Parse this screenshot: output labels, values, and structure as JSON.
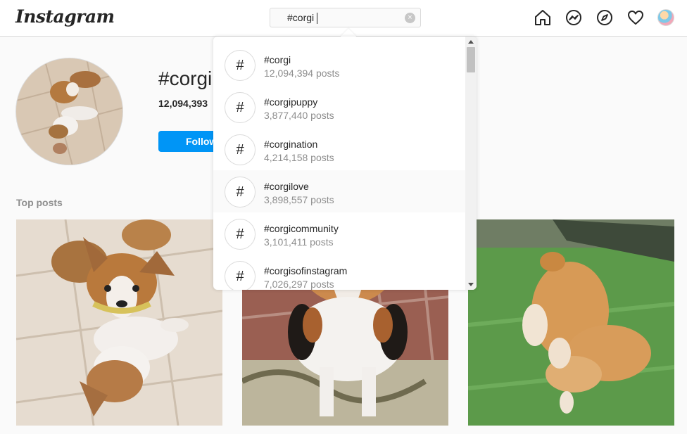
{
  "app": {
    "logo": "Instagram"
  },
  "search": {
    "value": "#corgi",
    "clear_icon": "×"
  },
  "nav": {
    "icons": [
      "home-icon",
      "messenger-icon",
      "explore-icon",
      "heart-icon",
      "profile-avatar"
    ]
  },
  "tag": {
    "title": "#corgi",
    "posts_count": "12,094,393",
    "follow_label": "Follow"
  },
  "sections": {
    "top_posts": "Top posts"
  },
  "suggestions": [
    {
      "hash": "#",
      "name": "#corgi",
      "count": "12,094,394 posts"
    },
    {
      "hash": "#",
      "name": "#corgipuppy",
      "count": "3,877,440 posts"
    },
    {
      "hash": "#",
      "name": "#corgination",
      "count": "4,214,158 posts"
    },
    {
      "hash": "#",
      "name": "#corgilove",
      "count": "3,898,557 posts"
    },
    {
      "hash": "#",
      "name": "#corgicommunity",
      "count": "3,101,411 posts"
    },
    {
      "hash": "#",
      "name": "#corgisofinstagram",
      "count": "7,026,297 posts"
    }
  ],
  "colors": {
    "accent": "#0095f6",
    "border": "#dbdbdb",
    "muted": "#8e8e8e"
  }
}
